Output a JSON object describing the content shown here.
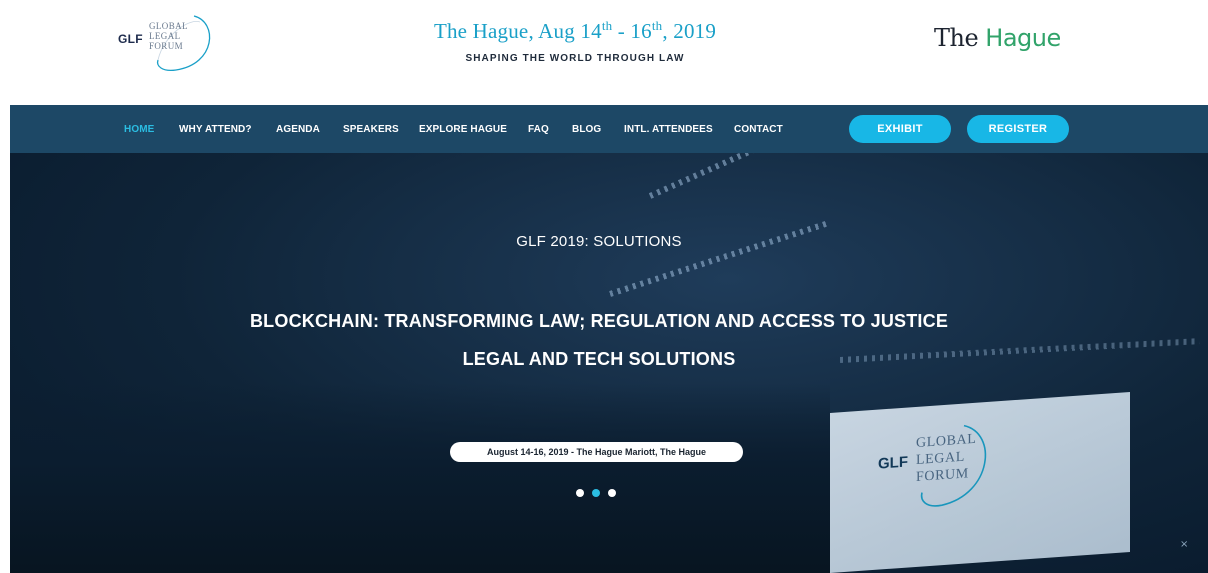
{
  "header": {
    "glf_logo": {
      "abbr": "GLF",
      "words": [
        "GLOBAL",
        "LEGAL",
        "FORUM"
      ]
    },
    "event": {
      "title_prefix": "The Hague, Aug 14",
      "sup1": "th",
      "middle": " - 16",
      "sup2": "th",
      "suffix": ", 2019",
      "subtitle": "SHAPING THE WORLD THROUGH LAW"
    },
    "hague_logo": {
      "part1": "The ",
      "accent": "Hague"
    }
  },
  "nav": {
    "items": [
      {
        "label": "HOME",
        "active": true
      },
      {
        "label": "WHY ATTEND?"
      },
      {
        "label": "AGENDA"
      },
      {
        "label": "SPEAKERS"
      },
      {
        "label": "EXPLORE HAGUE"
      },
      {
        "label": "FAQ"
      },
      {
        "label": "BLOG"
      },
      {
        "label": "INTL. ATTENDEES"
      },
      {
        "label": "CONTACT"
      }
    ],
    "exhibit_label": "EXHIBIT",
    "register_label": "REGISTER",
    "active_color": "#2bbde2",
    "button_color": "#18b7e6",
    "bar_color": "#1d4866"
  },
  "hero": {
    "tag": "GLF 2019: SOLUTIONS",
    "headline1": "BLOCKCHAIN: TRANSFORMING LAW; REGULATION AND ACCESS TO JUSTICE",
    "headline2": "LEGAL AND TECH SOLUTIONS",
    "date_pill": "August 14-16, 2019 - The Hague Mariott, The Hague",
    "carousel": {
      "slides": 3,
      "active_index": 1
    },
    "screen_logo": {
      "abbr": "GLF",
      "words": [
        "GLOBAL",
        "LEGAL",
        "FORUM"
      ]
    },
    "close_label": "×"
  }
}
